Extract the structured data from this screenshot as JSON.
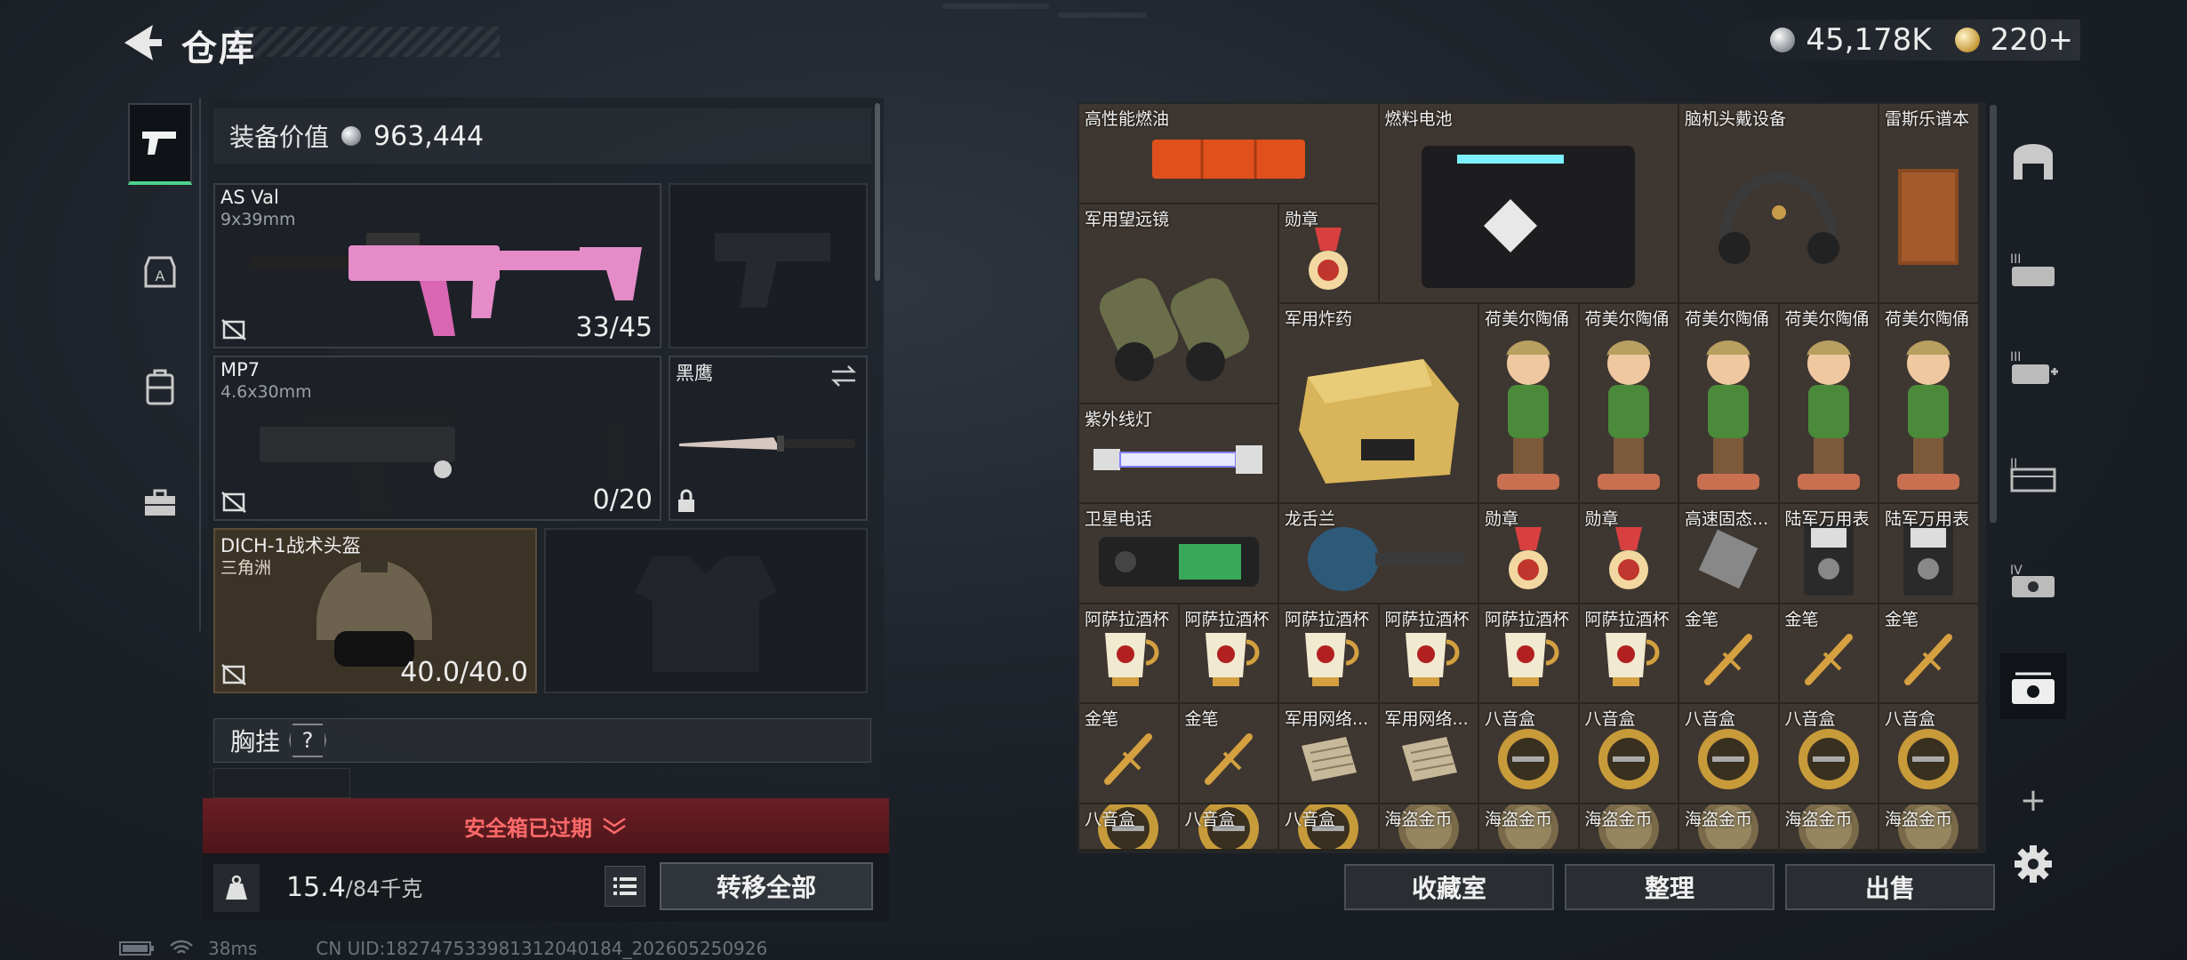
{
  "header": {
    "title": "仓库",
    "currency": {
      "silver": "45,178K",
      "gold": "220+"
    }
  },
  "equipment": {
    "value_label": "装备价值",
    "value": "963,444",
    "slots": [
      {
        "name": "AS Val",
        "caliber": "9x39mm",
        "durability": "33/45"
      },
      {
        "name": "MP7",
        "caliber": "4.6x30mm",
        "durability": "0/20"
      },
      {
        "name": "黑鹰"
      },
      {
        "name": "DICH-1战术头盔",
        "sub": "三角洲",
        "durability": "40.0/40.0"
      }
    ],
    "chest_rig": "胸挂",
    "help": "?"
  },
  "safebox": "安全箱已过期",
  "weight": {
    "current": "15.4",
    "max": "/84千克"
  },
  "transfer_all": "转移全部",
  "inventory": {
    "cells": [
      "高性能燃油",
      "燃料电池",
      "脑机头戴设备",
      "雷斯乐谱本",
      "军用望远镜",
      "勋章",
      "军用炸药",
      "荷美尔陶俑",
      "荷美尔陶俑",
      "荷美尔陶俑",
      "荷美尔陶俑",
      "荷美尔陶俑",
      "紫外线灯",
      "卫星电话",
      "龙舌兰",
      "勋章",
      "勋章",
      "高速固态...",
      "陆军万用表",
      "陆军万用表",
      "阿萨拉酒杯",
      "阿萨拉酒杯",
      "阿萨拉酒杯",
      "阿萨拉酒杯",
      "阿萨拉酒杯",
      "阿萨拉酒杯",
      "金笔",
      "金笔",
      "金笔",
      "金笔",
      "金笔",
      "军用网络...",
      "军用网络...",
      "八音盒",
      "八音盒",
      "八音盒",
      "八音盒",
      "八音盒",
      "八音盒",
      "八音盒",
      "八音盒",
      "海盗金币",
      "海盗金币",
      "海盗金币",
      "海盗金币",
      "海盗金币",
      "海盗金币"
    ]
  },
  "buttons": {
    "collection": "收藏室",
    "organize": "整理",
    "sell": "出售"
  },
  "right_rail": {
    "roman": [
      "III",
      "III",
      "II",
      "IV"
    ],
    "add": "+"
  },
  "status": {
    "ping": "38ms",
    "uid": "CN UID:1827475339813120401­84_202605250926"
  }
}
